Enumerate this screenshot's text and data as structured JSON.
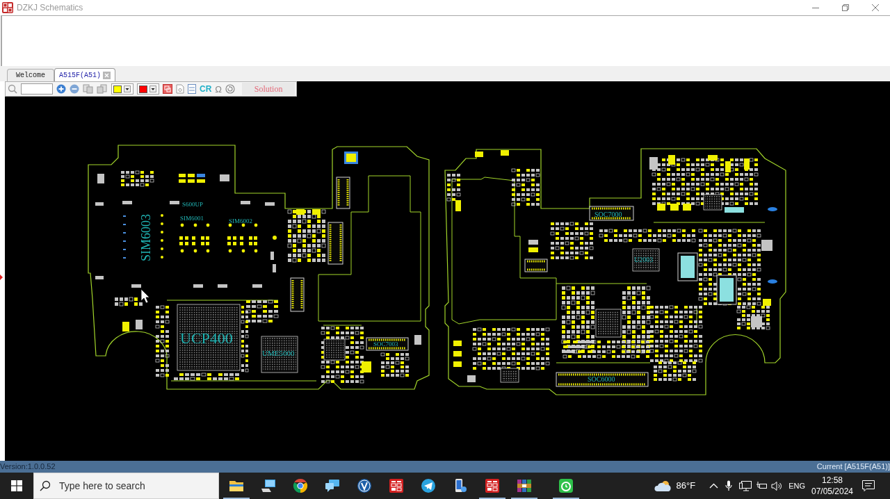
{
  "window": {
    "title": "DZKJ Schematics"
  },
  "tabs": [
    {
      "label": "Welcome",
      "selected": false
    },
    {
      "label": "A515F(A51)",
      "selected": true
    }
  ],
  "toolbar": {
    "color_pickers": [
      {
        "color": "#ffff00"
      },
      {
        "color": "#ff0000"
      }
    ],
    "cr_label": "CR",
    "omega_label": "Ω",
    "solution_button": "Solution"
  },
  "board": {
    "labels": [
      "SIM6003",
      "S600UP",
      "SIM6001",
      "SIM6002",
      "UCP400",
      "UME5000",
      "SOC7003",
      "SOC7000",
      "U2003",
      "SOC6000"
    ]
  },
  "status_bar": {
    "version": "Version:1.0.0.52",
    "current": "Current [A515F(A51)]"
  },
  "taskbar": {
    "search_placeholder": "Type here to search",
    "apps": [
      {
        "kind": "folder",
        "running": true
      },
      {
        "kind": "monitor",
        "running": false
      },
      {
        "kind": "browser",
        "running": false
      },
      {
        "kind": "chat",
        "running": false
      },
      {
        "kind": "vbadge",
        "running": false
      },
      {
        "kind": "tile",
        "running": false
      },
      {
        "kind": "plane",
        "running": false
      },
      {
        "kind": "phone",
        "running": false
      },
      {
        "kind": "tile",
        "running": true
      },
      {
        "kind": "books",
        "running": true
      },
      {
        "kind": "clock",
        "running": true
      }
    ],
    "weather": "86°F",
    "language": "ENG",
    "time": "12:58",
    "date": "07/05/2024"
  }
}
